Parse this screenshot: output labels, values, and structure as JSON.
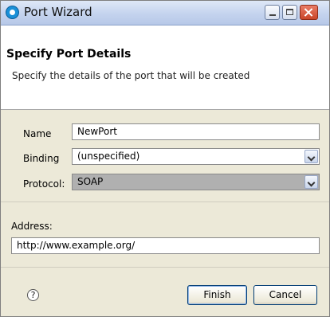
{
  "window": {
    "title": "Port Wizard",
    "controls": [
      "minimize-icon",
      "maximize-icon",
      "close-icon"
    ]
  },
  "header": {
    "title": "Specify Port Details",
    "description": "Specify the details of the port that will be created"
  },
  "form": {
    "name_label": "Name",
    "name_value": "NewPort",
    "binding_label": "Binding",
    "binding_value": "(unspecified)",
    "protocol_label": "Protocol:",
    "protocol_value": "SOAP",
    "address_label": "Address:",
    "address_value": "http://www.example.org/"
  },
  "footer": {
    "help_icon": "help-icon",
    "help_glyph": "?",
    "finish_label": "Finish",
    "cancel_label": "Cancel"
  },
  "colors": {
    "titlebar": "#c4d3ee",
    "dialog_bg": "#ece9d8",
    "protocol_bg": "#b0b0b0"
  }
}
